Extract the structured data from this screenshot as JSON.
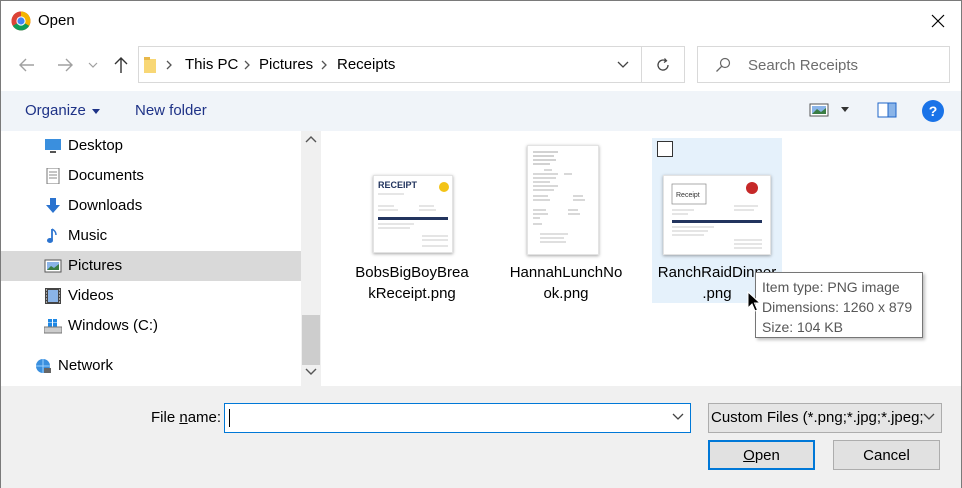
{
  "window": {
    "title": "Open",
    "close_icon": "close-icon"
  },
  "address": {
    "back_icon": "arrow-left-icon",
    "forward_icon": "arrow-right-icon",
    "recent_icon": "chevron-down-icon",
    "up_icon": "arrow-up-icon",
    "breadcrumb": [
      "This PC",
      "Pictures",
      "Receipts"
    ],
    "refresh_icon": "refresh-icon",
    "search_placeholder": "Search Receipts"
  },
  "toolbar": {
    "organize_label": "Organize",
    "new_folder_label": "New folder",
    "help_label": "?"
  },
  "nav": {
    "items": [
      {
        "label": "Desktop",
        "icon": "desktop-icon"
      },
      {
        "label": "Documents",
        "icon": "documents-icon"
      },
      {
        "label": "Downloads",
        "icon": "downloads-icon"
      },
      {
        "label": "Music",
        "icon": "music-icon"
      },
      {
        "label": "Pictures",
        "icon": "pictures-icon",
        "selected": true
      },
      {
        "label": "Videos",
        "icon": "videos-icon"
      },
      {
        "label": "Windows (C:)",
        "icon": "drive-icon"
      },
      {
        "label": "Network",
        "icon": "network-icon"
      }
    ]
  },
  "files": [
    {
      "name": "BobsBigBoyBreakReceipt.png",
      "name_line1": "BobsBigBoyBrea",
      "name_line2": "kReceipt.png",
      "thumb_title": "RECEIPT"
    },
    {
      "name": "HannahLunchNook.png",
      "name_line1": "HannahLunchNo",
      "name_line2": "ok.png"
    },
    {
      "name": "RanchRaidDinner.png",
      "name_line1": "RanchRaidDinner",
      "name_line2": ".png",
      "thumb_title": "Receipt",
      "selected": true
    }
  ],
  "tooltip": {
    "type": "Item type: PNG image",
    "dimensions": "Dimensions: 1260 x 879",
    "size": "Size: 104 KB"
  },
  "footer": {
    "file_name_label_prefix": "File ",
    "file_name_label_underlined": "n",
    "file_name_label_suffix": "ame:",
    "file_name_value": "",
    "filter_value": "Custom Files (*.png;*.jpg;*.jpeg;",
    "open_underlined": "O",
    "open_rest": "pen",
    "cancel_label": "Cancel"
  }
}
